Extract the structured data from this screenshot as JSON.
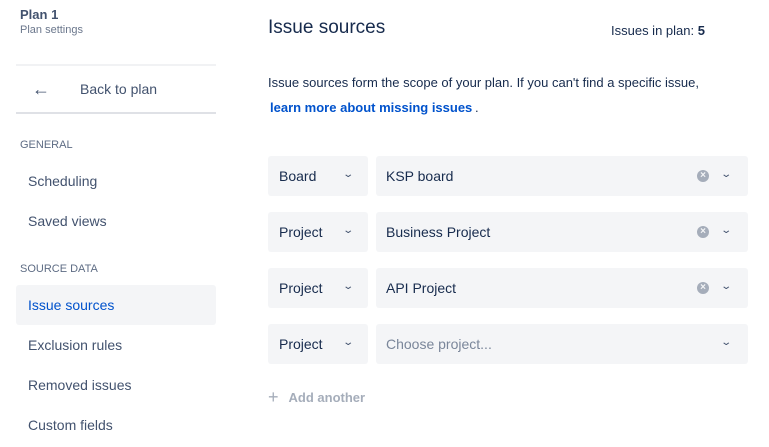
{
  "sidebar": {
    "plan_title": "Plan 1",
    "plan_subtitle": "Plan settings",
    "back_label": "Back to plan",
    "sections": [
      {
        "title": "GENERAL",
        "items": [
          "Scheduling",
          "Saved views"
        ]
      },
      {
        "title": "SOURCE DATA",
        "items": [
          "Issue sources",
          "Exclusion rules",
          "Removed issues",
          "Custom fields"
        ]
      }
    ],
    "active": "Issue sources"
  },
  "main": {
    "title": "Issue sources",
    "count_label": "Issues in plan:",
    "count": "5",
    "intro": "Issue sources form the scope of your plan. If you can't find a specific issue,",
    "learn_link": "learn more about missing issues",
    "period": ".",
    "sources": [
      {
        "type": "Board",
        "value": "KSP board"
      },
      {
        "type": "Project",
        "value": "Business Project"
      },
      {
        "type": "Project",
        "value": "API Project"
      },
      {
        "type": "Project",
        "value": "",
        "placeholder": "Choose project..."
      }
    ],
    "add_label": "Add another"
  }
}
